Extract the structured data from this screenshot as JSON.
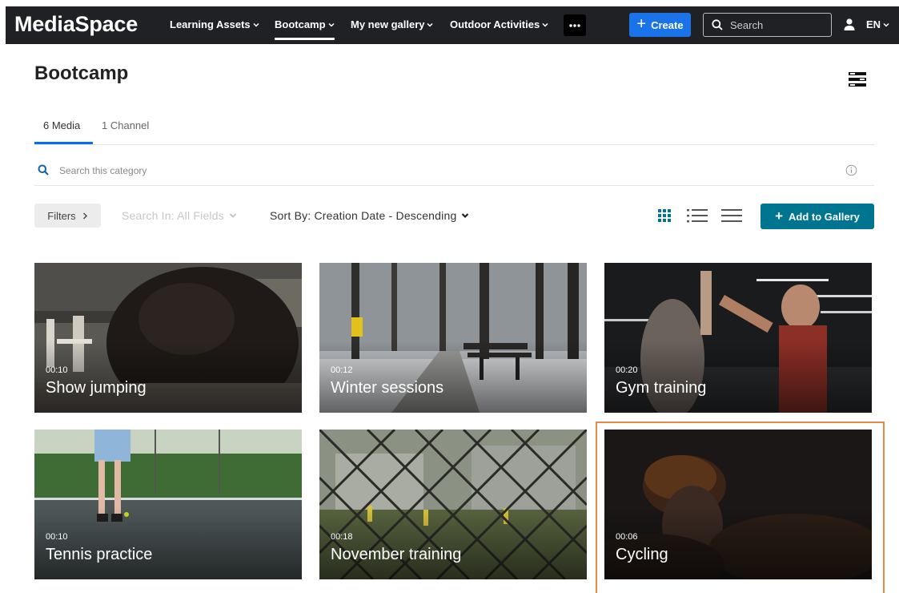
{
  "app": {
    "brand": "MediaSpace"
  },
  "nav": {
    "items": [
      {
        "label": "Learning Assets",
        "active": false
      },
      {
        "label": "Bootcamp",
        "active": true
      },
      {
        "label": "My new gallery",
        "active": false
      },
      {
        "label": "Outdoor Activities",
        "active": false
      }
    ],
    "more_icon": "ellipsis-icon",
    "create_label": "Create",
    "search_placeholder": "Search",
    "language": "EN"
  },
  "page": {
    "title": "Bootcamp",
    "tabs": [
      {
        "label": "6 Media",
        "active": true
      },
      {
        "label": "1 Channel",
        "active": false
      }
    ],
    "category_search_placeholder": "Search this category"
  },
  "toolbar": {
    "filters_label": "Filters",
    "search_in_label": "Search In: All Fields",
    "sort_label": "Sort By: Creation Date - Descending",
    "view_modes": [
      "grid-view-icon",
      "detailed-view-icon",
      "list-view-icon"
    ],
    "active_view": "grid",
    "add_to_gallery_label": "Add to Gallery"
  },
  "media": [
    {
      "title": "Show jumping",
      "duration": "00:10"
    },
    {
      "title": "Winter sessions",
      "duration": "00:12"
    },
    {
      "title": "Gym training",
      "duration": "00:20"
    },
    {
      "title": "Tennis practice",
      "duration": "00:10"
    },
    {
      "title": "November training",
      "duration": "00:18"
    },
    {
      "title": "Cycling",
      "duration": "00:06"
    }
  ],
  "colors": {
    "topbar": "#202124",
    "create_button": "#1a73e8",
    "add_to_gallery": "#00758f",
    "active_tab_underline": "#006efa",
    "grid_view_active": "#00758f",
    "focus_outline": "#e8894a"
  }
}
